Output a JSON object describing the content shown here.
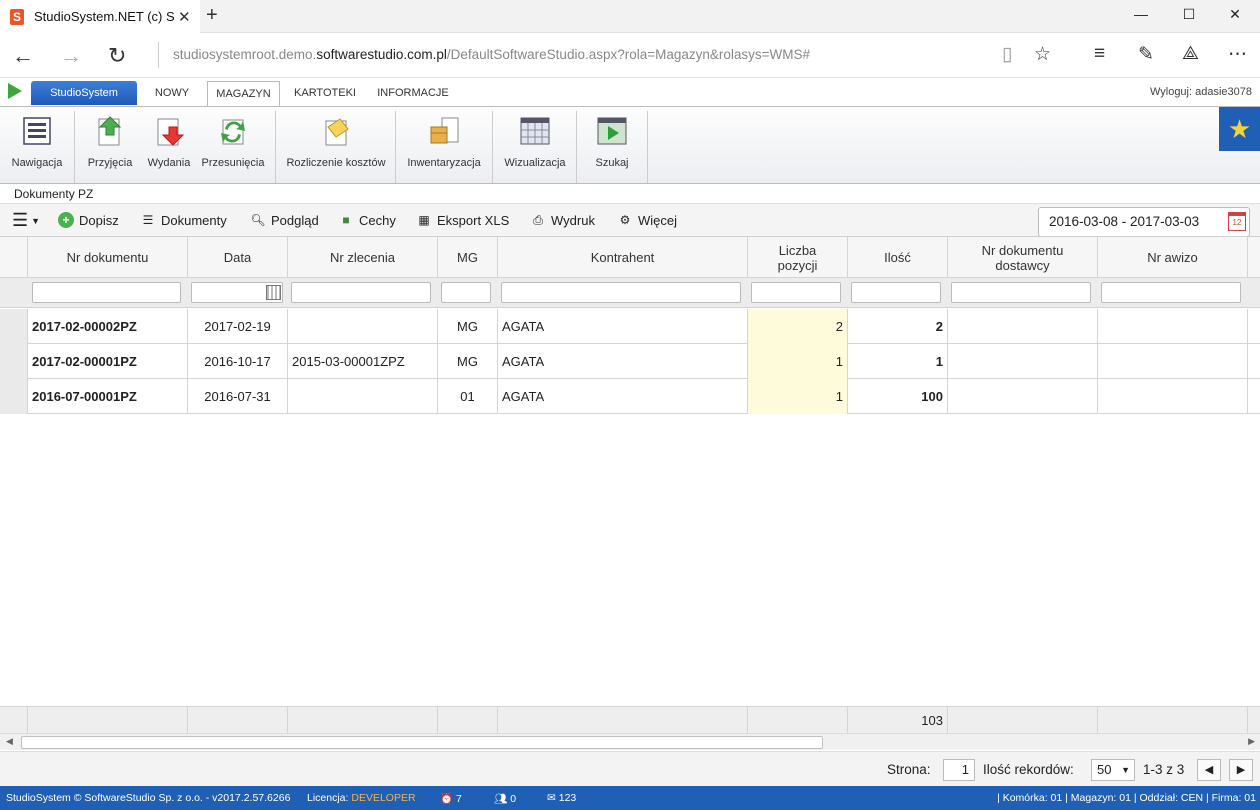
{
  "browser": {
    "tab_title": "StudioSystem.NET (c) Sc",
    "url_prefix": "studiosystemroot.demo.",
    "url_domain": "softwarestudio.com.pl",
    "url_path": "/DefaultSoftwareStudio.aspx?rola=Magazyn&rolasys=WMS#"
  },
  "ribbon_tabs": {
    "studio": "StudioSystem",
    "tabs": [
      "NOWY",
      "MAGAZYN",
      "KARTOTEKI",
      "INFORMACJE"
    ],
    "active": "MAGAZYN",
    "logout": "Wyloguj: adasie3078"
  },
  "ribbon": {
    "nav": "Nawigacja",
    "przyjecia": "Przyjęcia",
    "wydania": "Wydania",
    "przesuniecia": "Przesunięcia",
    "rozliczenie": "Rozliczenie kosztów",
    "inwentaryzacja": "Inwentaryzacja",
    "wizualizacja": "Wizualizacja",
    "szukaj": "Szukaj"
  },
  "page": {
    "title": "Dokumenty PZ"
  },
  "toolbar": {
    "dopisz": "Dopisz",
    "dokumenty": "Dokumenty",
    "podglad": "Podgląd",
    "cechy": "Cechy",
    "eksport": "Eksport XLS",
    "wydruk": "Wydruk",
    "wiecej": "Więcej",
    "date_range": "2016-03-08 - 2017-03-03"
  },
  "grid": {
    "columns": [
      "Nr dokumentu",
      "Data",
      "Nr zlecenia",
      "MG",
      "Kontrahent",
      "Liczba pozycji",
      "Ilość",
      "Nr dokumentu dostawcy",
      "Nr awizo"
    ],
    "rows": [
      {
        "nr": "2017-02-00002PZ",
        "data": "2017-02-19",
        "zlecenie": "",
        "mg": "MG",
        "kontrahent": "AGATA",
        "liczba": "2",
        "ilosc": "2"
      },
      {
        "nr": "2017-02-00001PZ",
        "data": "2016-10-17",
        "zlecenie": "2015-03-00001ZPZ",
        "mg": "MG",
        "kontrahent": "AGATA",
        "liczba": "1",
        "ilosc": "1"
      },
      {
        "nr": "2016-07-00001PZ",
        "data": "2016-07-31",
        "zlecenie": "",
        "mg": "01",
        "kontrahent": "AGATA",
        "liczba": "1",
        "ilosc": "100"
      }
    ],
    "sum_ilosc": "103"
  },
  "pager": {
    "strona_label": "Strona:",
    "strona": "1",
    "ilosc_label": "Ilość rekordów:",
    "ilosc": "50",
    "range": "1-3 z 3"
  },
  "status": {
    "copyright": "StudioSystem © SoftwareStudio Sp. z o.o. - v2017.2.57.6266",
    "licencja_label": "Licencja:",
    "licencja": "DEVELOPER",
    "alarms": "7",
    "users": "0",
    "messages": "123",
    "right": "| Komórka: 01 | Magazyn: 01 | Oddział: CEN | Firma: 01"
  },
  "colors": {
    "accent": "#1f5fb5",
    "highlight": "#fdfbd9"
  }
}
